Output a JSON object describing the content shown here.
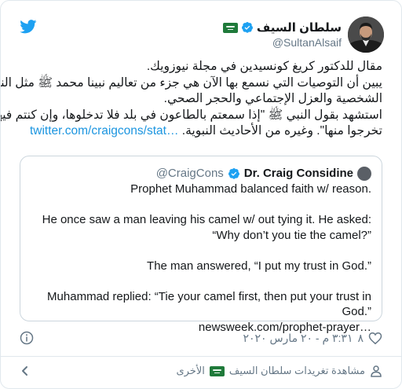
{
  "author": {
    "name": "سلطان السيف",
    "handle": "@SultanAlsaif",
    "verified": true
  },
  "tweet": {
    "lines": [
      "مقال للدكتور كريغ كونسيدين في مجلة نيوزويك.",
      "يبين أن التوصيات التي نسمع بها الآن هي جزء من تعاليم نبينا محمد ﷺ مثل النظافة",
      "الشخصية والعزل الإجتماعي والحجر الصحي.",
      "استشهد بقول النبي ﷺ \"إذا سمعتم بالطاعون في بلد فلا تدخلوها، وإن كنتم فيها فلا",
      "تخرجوا منها\". وغيره من الأحاديث النبوية."
    ],
    "link": "twitter.com/craigcons/stat…"
  },
  "quote": {
    "name": "Dr. Craig Considine",
    "handle": "@CraigCons",
    "verified": true,
    "lines": [
      "Prophet Muhammad balanced faith w/ reason.",
      "",
      "He once saw a man leaving his camel w/ out tying it. He asked:",
      "“Why don’t you tie the camel?”",
      "",
      "The man answered, “I put my trust in God.”",
      "",
      "Muhammad replied: “Tie your camel first, then put your trust in God.”"
    ],
    "link": "newsweek.com/prophet-prayer…"
  },
  "meta": {
    "like_count": "٨",
    "timestamp": "٣:٣١ م - ٢٠ مارس ٢٠٢٠"
  },
  "footer": {
    "text": "مشاهدة تغريدات سلطان السيف",
    "text_suffix": "الأخرى"
  },
  "colors": {
    "twitter_blue": "#1da1f2",
    "link_blue": "#1b95e0",
    "secondary_text": "#657786",
    "border": "#ccd6dd"
  },
  "icons": {
    "logo": "twitter-bird-icon",
    "verified": "verified-badge-icon",
    "flag": "saudi-flag-icon",
    "info": "info-icon",
    "like": "heart-icon",
    "back": "chevron-left-icon",
    "user": "user-icon"
  }
}
